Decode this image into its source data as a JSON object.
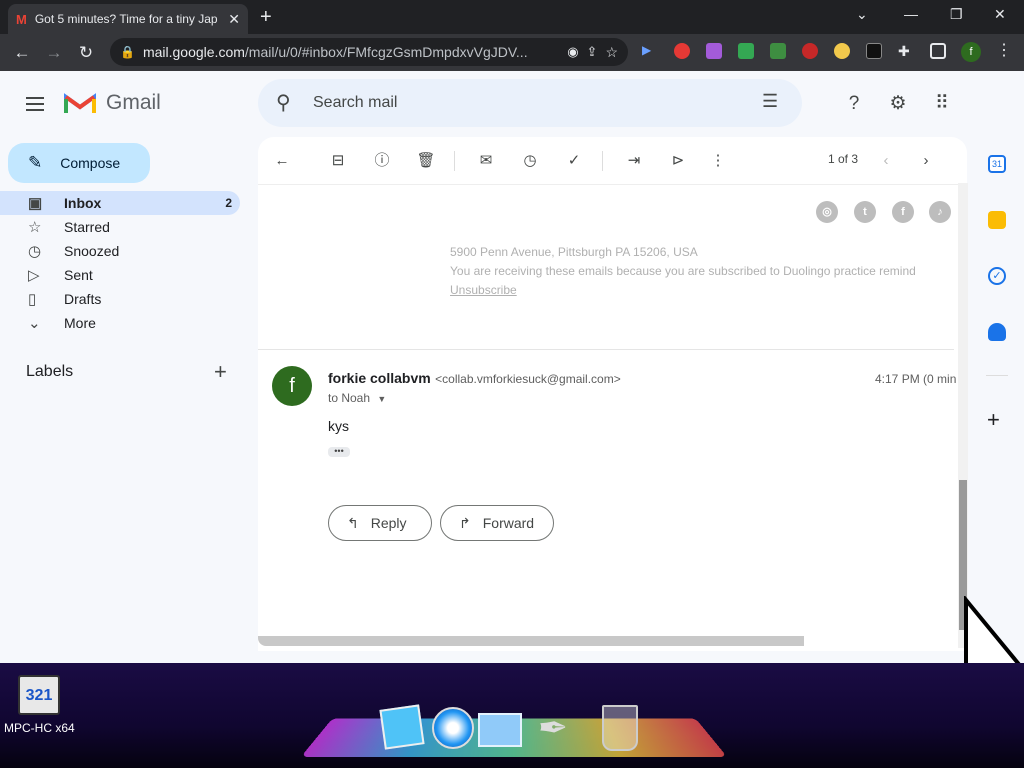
{
  "browser": {
    "tab_title": "Got 5 minutes? Time for a tiny Jap",
    "url_host": "mail.google.com",
    "url_path": "/mail/u/0/#inbox/FMfcgzGsmDmpdxvVgJDV..."
  },
  "gmail": {
    "logo_text": "Gmail",
    "search_placeholder": "Search mail",
    "account_initial": "f",
    "compose_label": "Compose",
    "nav": [
      {
        "label": "Inbox",
        "count": "2",
        "icon": "inbox-icon"
      },
      {
        "label": "Starred",
        "count": "",
        "icon": "star-icon"
      },
      {
        "label": "Snoozed",
        "count": "",
        "icon": "clock-icon"
      },
      {
        "label": "Sent",
        "count": "",
        "icon": "send-icon"
      },
      {
        "label": "Drafts",
        "count": "",
        "icon": "draft-icon"
      },
      {
        "label": "More",
        "count": "",
        "icon": "chevron-down-icon"
      }
    ],
    "labels_heading": "Labels",
    "pagination": "1 of 3"
  },
  "previous_message": {
    "address": "5900 Penn Avenue, Pittsburgh PA 15206, USA",
    "notice": "You are receiving these emails because you are subscribed to Duolingo practice remind",
    "unsubscribe": "Unsubscribe"
  },
  "message": {
    "sender_initial": "f",
    "sender_name": "forkie collabvm",
    "sender_email": "<collab.vmforkiesuck@gmail.com>",
    "time": "4:17 PM (0 min",
    "recipient": "to Noah",
    "body": "kys",
    "reply_label": "Reply",
    "forward_label": "Forward"
  },
  "taskbar": {
    "mpc_label": "MPC-HC x64"
  },
  "colors": {
    "accent_blue": "#0b57d0",
    "compose_bg": "#c2e7ff",
    "active_nav": "#d3e3fd",
    "avatar_green": "#2e6b1f"
  }
}
